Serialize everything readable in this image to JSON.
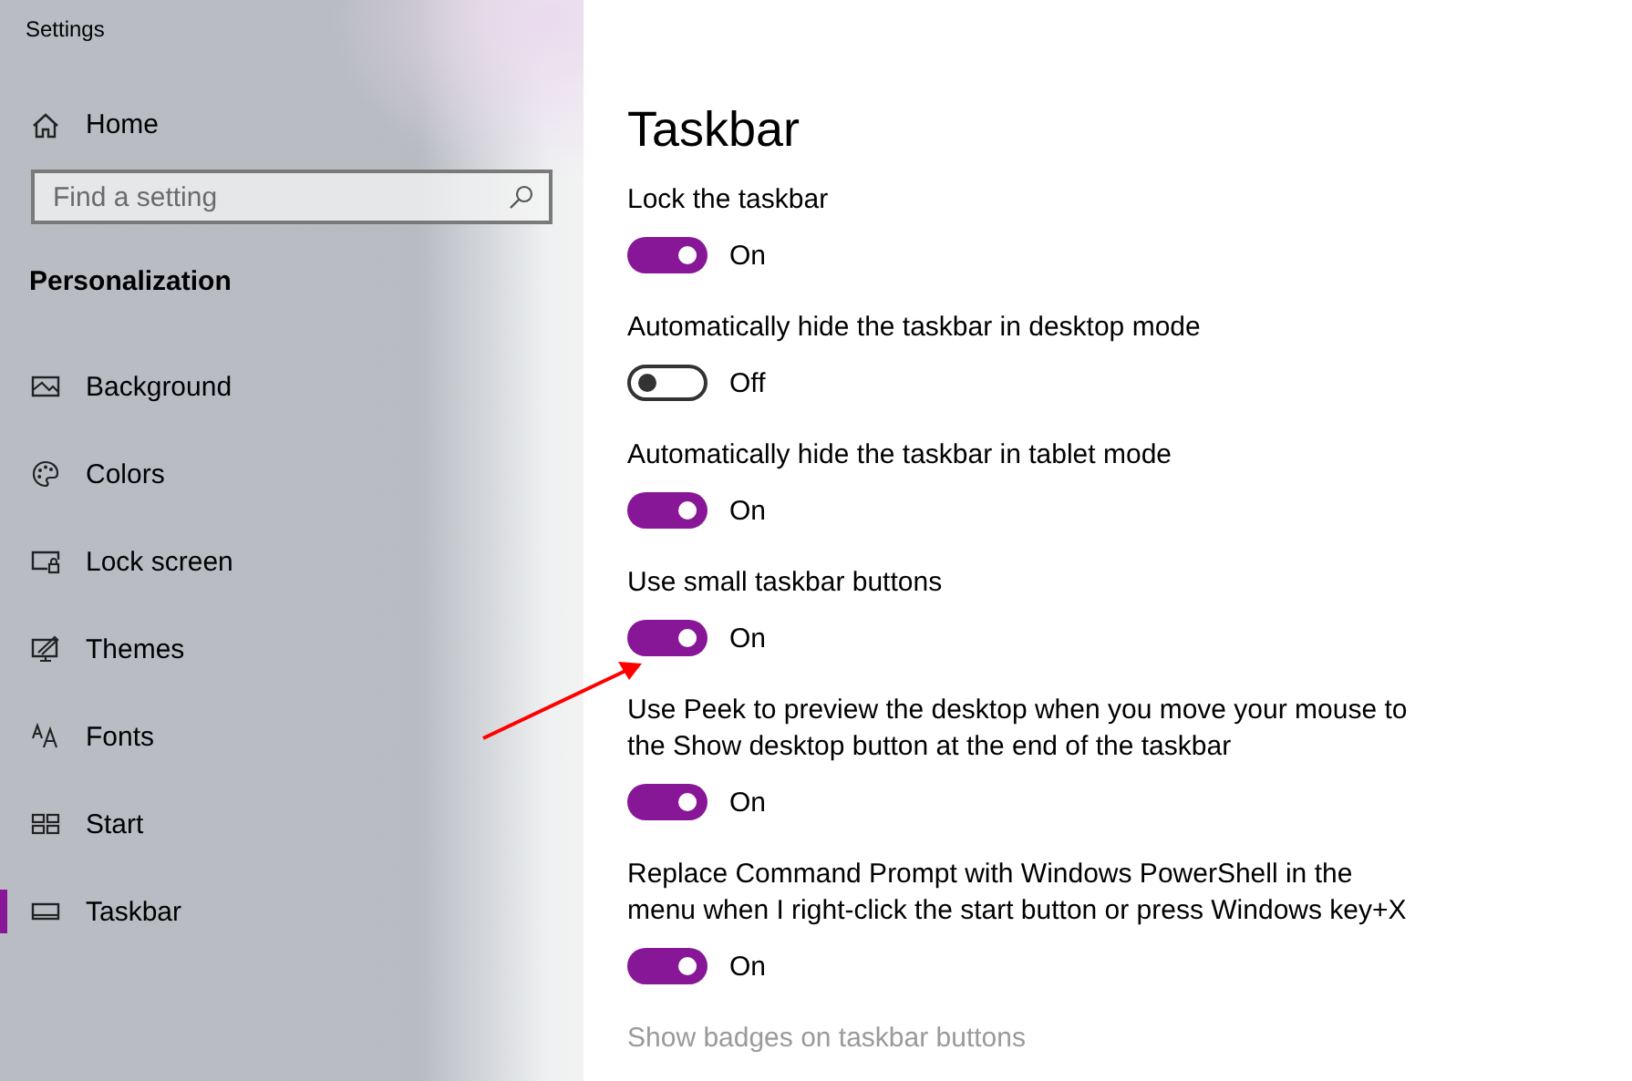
{
  "window": {
    "title": "Settings"
  },
  "sidebar": {
    "home": {
      "label": "Home"
    },
    "search": {
      "placeholder": "Find a setting"
    },
    "section": "Personalization",
    "items": [
      {
        "label": "Background",
        "selected": false
      },
      {
        "label": "Colors",
        "selected": false
      },
      {
        "label": "Lock screen",
        "selected": false
      },
      {
        "label": "Themes",
        "selected": false
      },
      {
        "label": "Fonts",
        "selected": false
      },
      {
        "label": "Start",
        "selected": false
      },
      {
        "label": "Taskbar",
        "selected": true
      }
    ]
  },
  "page": {
    "title": "Taskbar",
    "settings": [
      {
        "label": "Lock the taskbar",
        "on": true,
        "state_label": "On",
        "disabled": false
      },
      {
        "label": "Automatically hide the taskbar in desktop mode",
        "on": false,
        "state_label": "Off",
        "disabled": false
      },
      {
        "label": "Automatically hide the taskbar in tablet mode",
        "on": true,
        "state_label": "On",
        "disabled": false
      },
      {
        "label": "Use small taskbar buttons",
        "on": true,
        "state_label": "On",
        "disabled": false
      },
      {
        "label": "Use Peek to preview the desktop when you move your mouse to the Show desktop button at the end of the taskbar",
        "on": true,
        "state_label": "On",
        "disabled": false
      },
      {
        "label": "Replace Command Prompt with Windows PowerShell in the menu when I right-click the start button or press Windows key+X",
        "on": true,
        "state_label": "On",
        "disabled": false
      },
      {
        "label": "Show badges on taskbar buttons",
        "disabled": true
      }
    ]
  }
}
